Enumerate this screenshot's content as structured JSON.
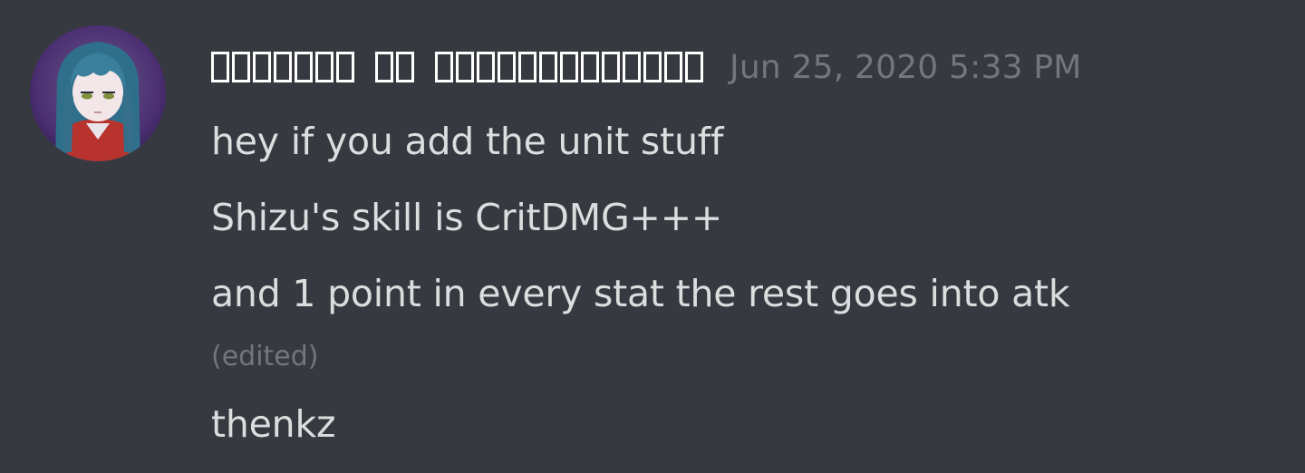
{
  "message": {
    "author": {
      "name": "ꜱʜɪᴢᴜʀᴜ ᴏꜰ ʙʟᴀᴄᴋʙᴇʀʀʏᴄʟᴏᴠᴇʀ",
      "avatar_icon": "anime-avatar-icon"
    },
    "timestamp": "Jun 25, 2020 5:33 PM",
    "lines": [
      "hey if you add the unit stuff",
      "Shizu's skill is CritDMG+++",
      "and 1 point in every stat the rest goes into atk",
      "thenkz"
    ],
    "edited_label": "(edited)"
  },
  "colors": {
    "background": "#36393f",
    "username": "#ffffff",
    "timestamp": "#72767d",
    "message_text": "#dcddde",
    "edited": "#72767d"
  }
}
